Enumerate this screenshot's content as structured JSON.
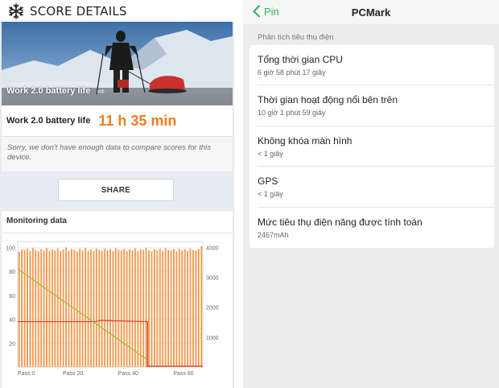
{
  "left": {
    "title": "SCORE DETAILS",
    "hero_label": "Work 2.0 battery life",
    "hero_arrow": "⇨",
    "result_label": "Work 2.0 battery life",
    "result_value": "11 h 35 min",
    "sorry_text": "Sorry, we don't have enough data to compare scores for this device.",
    "share_label": "SHARE",
    "monitoring_title": "Monitoring data"
  },
  "right": {
    "back_label": "Pin",
    "title": "PCMark",
    "section_label": "Phân tích tiêu thụ điện",
    "rows": [
      {
        "title": "Tổng thời gian CPU",
        "sub": "6 giờ 58 phút 17 giây"
      },
      {
        "title": "Thời gian hoạt động nổi bên trên",
        "sub": "10 giờ 1 phút 59 giây"
      },
      {
        "title": "Không khóa màn hình",
        "sub": "< 1 giây"
      },
      {
        "title": "GPS",
        "sub": "< 1 giây"
      },
      {
        "title": "Mức tiêu thụ điện năng được tính toán",
        "sub": "2467mAh"
      }
    ]
  },
  "colors": {
    "accent_orange": "#f07d1e",
    "accent_green": "#2fb457",
    "bar_orange": "#f29a50",
    "battery_line": "#9bbf2f",
    "temp_line": "#d3412e"
  },
  "chart_data": {
    "type": "bar",
    "left_axis_ticks": [
      "100",
      "80",
      "60",
      "40",
      "20"
    ],
    "right_axis_ticks": [
      "4000",
      "3000",
      "2000",
      "1000"
    ],
    "x_tick_labels": [
      "Pass 0",
      "Pass 20",
      "Pass 40",
      "Pass 60"
    ],
    "ylim_left": [
      0,
      105
    ],
    "ylim_right": [
      0,
      4200
    ],
    "xlim": [
      0,
      67
    ],
    "pass_values": [
      3860,
      3940,
      3910,
      3960,
      3880,
      3990,
      3920,
      3870,
      3950,
      3900,
      3980,
      3890,
      3940,
      3910,
      3970,
      3880,
      3930,
      4000,
      3890,
      3950,
      3920,
      3870,
      3960,
      3910,
      3990,
      3900,
      3940,
      3880,
      3970,
      3920,
      3890,
      3960,
      3910,
      3950,
      3870,
      3980,
      3920,
      3900,
      3960,
      3890,
      3940,
      3910,
      3970,
      3880,
      3950,
      3920,
      3990,
      3900,
      3870,
      3940,
      3910,
      3960,
      3890,
      3980,
      3920,
      3900,
      3950,
      3870,
      3960,
      3910,
      3940,
      3890,
      3970,
      3920,
      3900,
      3950,
      4040
    ],
    "battery_line": {
      "x": [
        0,
        47
      ],
      "y": [
        82,
        6
      ]
    },
    "temperature_line": {
      "x": [
        0,
        28,
        30,
        47
      ],
      "y": [
        38,
        38,
        39,
        38
      ]
    },
    "battery_stop_pass": 47
  }
}
